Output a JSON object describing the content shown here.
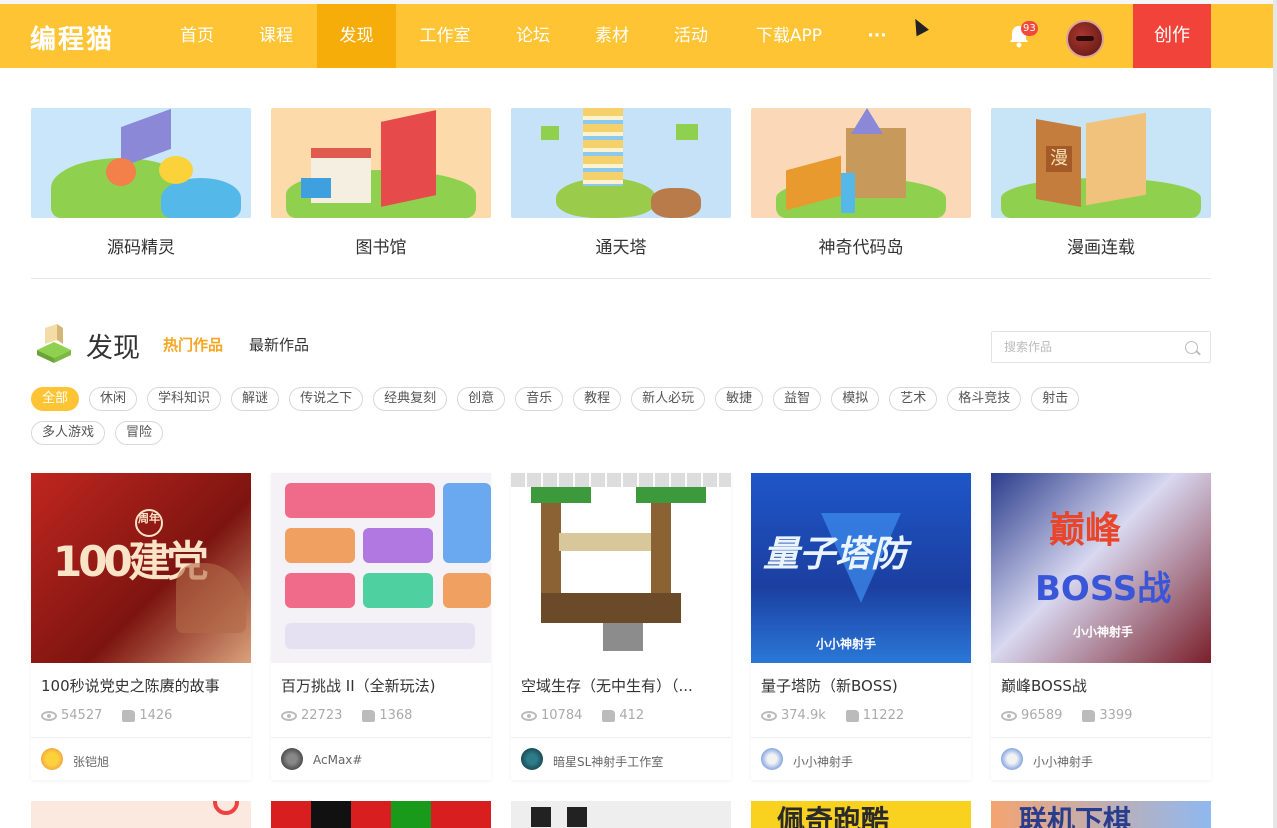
{
  "nav": {
    "logo": "编程猫",
    "items": [
      "首页",
      "课程",
      "发现",
      "工作室",
      "论坛",
      "素材",
      "活动",
      "下载APP",
      "···"
    ],
    "active": "发现",
    "notification_count": "93",
    "create_label": "创作",
    "colors": {
      "bar": "#fec433",
      "active": "#f6ad09",
      "create": "#f1433a"
    }
  },
  "features": [
    {
      "label": "源码精灵",
      "bg": "#c9e6fb"
    },
    {
      "label": "图书馆",
      "bg": "#fddaa9"
    },
    {
      "label": "通天塔",
      "bg": "#c5e2f9"
    },
    {
      "label": "神奇代码岛",
      "bg": "#fbd9b8"
    },
    {
      "label": "漫画连载",
      "bg": "#c8e4f7"
    }
  ],
  "discover": {
    "title": "发现",
    "tab_hot": "热门作品",
    "tab_new": "最新作品",
    "search_placeholder": "搜索作品"
  },
  "tags": [
    "全部",
    "休闲",
    "学科知识",
    "解谜",
    "传说之下",
    "经典复刻",
    "创意",
    "音乐",
    "教程",
    "新人必玩",
    "敏捷",
    "益智",
    "模拟",
    "艺术",
    "格斗竞技",
    "射击",
    "多人游戏",
    "冒险"
  ],
  "cards": [
    {
      "title": "100秒说党史之陈赓的故事",
      "views": "54527",
      "likes": "1426",
      "author": "张铠旭",
      "thumb_text": "100建党",
      "thumb_sub": "周年"
    },
    {
      "title": "百万挑战 II（全新玩法)",
      "views": "22723",
      "likes": "1368",
      "author": "AcMax#",
      "thumb_text": ""
    },
    {
      "title": "空域生存（无中生有）（...",
      "views": "10784",
      "likes": "412",
      "author": "暗星SL神射手工作室",
      "thumb_text": ""
    },
    {
      "title": "量子塔防（新BOSS)",
      "views": "374.9k",
      "likes": "11222",
      "author": "小小神射手",
      "thumb_text": "量子塔防",
      "thumb_sub": "小小神射手"
    },
    {
      "title": "巅峰BOSS战",
      "views": "96589",
      "likes": "3399",
      "author": "小小神射手",
      "thumb_text": "巅峰",
      "thumb_text2": "BOSS战",
      "thumb_sub": "小小神射手"
    }
  ],
  "bottom_cards": [
    {
      "thumb_text": ""
    },
    {
      "thumb_text": ""
    },
    {
      "thumb_text": ""
    },
    {
      "thumb_text": "佩奇跑酷"
    },
    {
      "thumb_text": "联机下棋"
    }
  ]
}
